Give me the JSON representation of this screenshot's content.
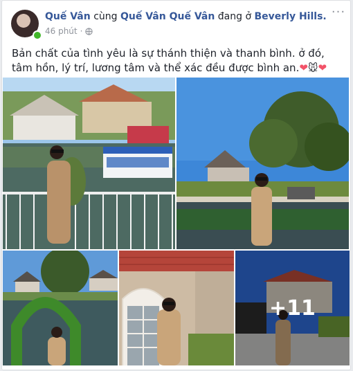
{
  "post": {
    "author": "Quế Vân",
    "with_text": "cùng",
    "tagged": "Quế Vân Quế Vân",
    "at_text": "đang ở",
    "location": "Beverly Hills.",
    "time": "46 phút",
    "separator": "·",
    "more_label": "···",
    "text_main": "Bản chất của tình yêu là sự thánh thiện và thanh bình. ở đó, tâm hồn, lý trí, lương tâm và thể xác đều được bình an.",
    "heart1": "❤",
    "mouse": "🐭",
    "heart2": "❤"
  },
  "photos": {
    "more_count": "+11"
  },
  "colors": {
    "link": "#365899",
    "online": "#42b72a",
    "meta": "#90949c"
  }
}
